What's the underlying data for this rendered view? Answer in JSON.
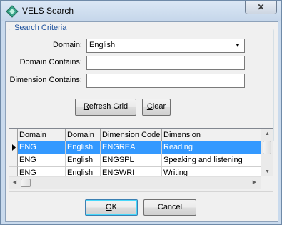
{
  "window": {
    "title": "VELS Search",
    "close_glyph": "✕"
  },
  "criteria": {
    "legend": "Search Criteria",
    "domain_label": "Domain:",
    "domain_value": "English",
    "domain_contains_label": "Domain Contains:",
    "domain_contains_value": "",
    "dimension_contains_label": "Dimension Contains:",
    "dimension_contains_value": "",
    "refresh_prefix": "R",
    "refresh_rest": "efresh Grid",
    "clear_prefix": "C",
    "clear_rest": "lear"
  },
  "grid": {
    "columns": [
      "Domain Code",
      "Domain",
      "Dimension Code",
      "Dimension"
    ],
    "rows": [
      {
        "code": "ENG",
        "domain": "English",
        "dim_code": "ENGREA",
        "dimension": "Reading",
        "selected": true
      },
      {
        "code": "ENG",
        "domain": "English",
        "dim_code": "ENGSPL",
        "dimension": "Speaking and listening",
        "selected": false
      },
      {
        "code": "ENG",
        "domain": "English",
        "dim_code": "ENGWRI",
        "dimension": "Writing",
        "selected": false
      }
    ]
  },
  "footer": {
    "ok_prefix": "O",
    "ok_rest": "K",
    "cancel_label": "Cancel"
  },
  "icons": {
    "app": "app-icon",
    "dropdown": "chevron-down-icon",
    "row_pointer": "row-pointer-icon"
  },
  "colors": {
    "selection": "#3399ff",
    "legend_text": "#1a4f9c"
  }
}
